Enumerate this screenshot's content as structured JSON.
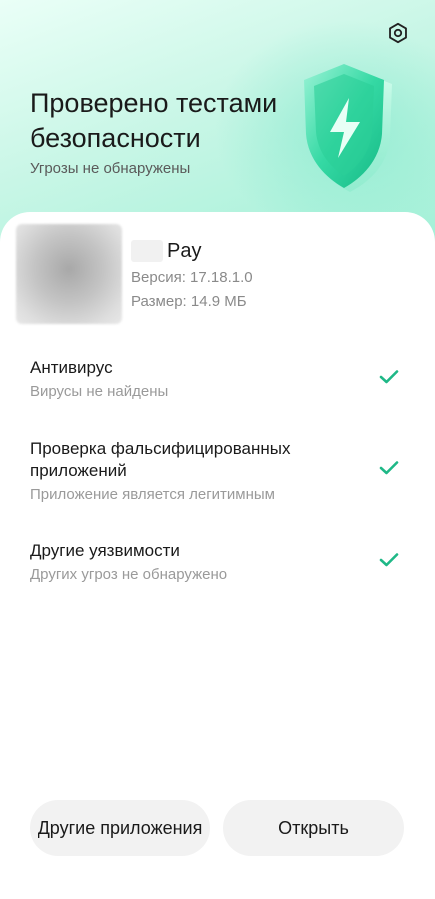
{
  "header": {
    "title": "Проверено тестами безопасности",
    "subtitle": "Угрозы не обнаружены",
    "settings_icon": "gear-icon",
    "shield_icon": "shield-lightning-icon",
    "accent": "#20c997"
  },
  "app": {
    "name": "Pay",
    "version": "Версия: 17.18.1.0",
    "size": "Размер: 14.9 МБ"
  },
  "checks": [
    {
      "title": "Антивирус",
      "subtitle": "Вирусы не найдены",
      "status_icon": "check-icon"
    },
    {
      "title": "Проверка фальсифицированных приложений",
      "subtitle": "Приложение является легитимным",
      "status_icon": "check-icon"
    },
    {
      "title": "Другие уязвимости",
      "subtitle": "Других угроз не обнаружено",
      "status_icon": "check-icon"
    }
  ],
  "actions": {
    "other_apps": "Другие приложения",
    "open": "Открыть"
  }
}
